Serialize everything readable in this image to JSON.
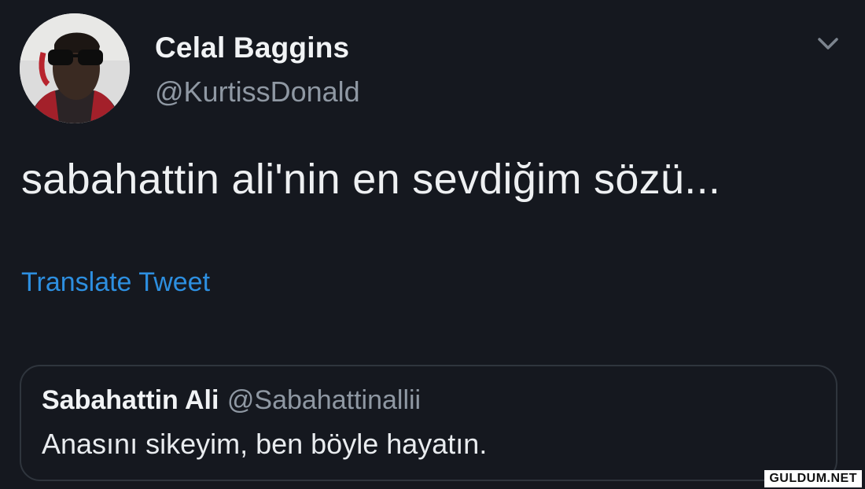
{
  "author": {
    "display_name": "Celal Baggins",
    "handle": "@KurtissDonald",
    "avatar_icon": "user-avatar-photo"
  },
  "menu_icon": "chevron-down-icon",
  "tweet": {
    "text": "sabahattin ali'nin en sevdiğim sözü..."
  },
  "translate_label": "Translate Tweet",
  "quoted_tweet": {
    "display_name": "Sabahattin Ali",
    "handle": "@Sabahattinallii",
    "text": "Anasını sikeyim, ben böyle hayatın."
  },
  "watermark": "GULDUM.NET",
  "colors": {
    "background": "#15181f",
    "link": "#2d8fe0",
    "secondary_text": "#8f98a3",
    "border": "#2f353d"
  }
}
